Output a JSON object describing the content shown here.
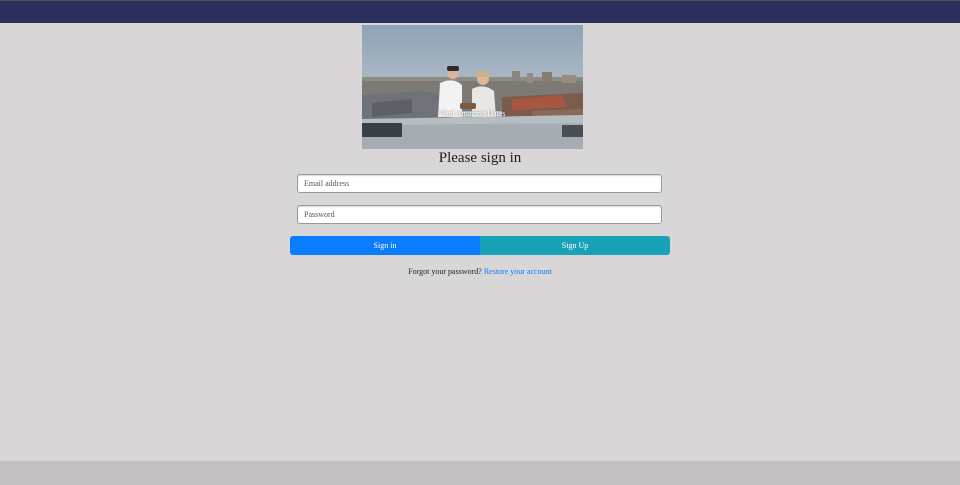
{
  "hero": {
    "caption": "Find Amazing Dates"
  },
  "signin": {
    "heading": "Please sign in",
    "email_placeholder": "Email address",
    "password_placeholder": "Password",
    "signin_label": "Sign in",
    "signup_label": "Sign Up",
    "forgot_text": "Forgot your password?",
    "restore_link": "Restore your account"
  },
  "colors": {
    "navbar": "#2a2f5c",
    "background": "#d8d6d7",
    "footer": "#c4bfc0",
    "signin_button": "#0a7cff",
    "signup_button": "#17a2b8"
  }
}
